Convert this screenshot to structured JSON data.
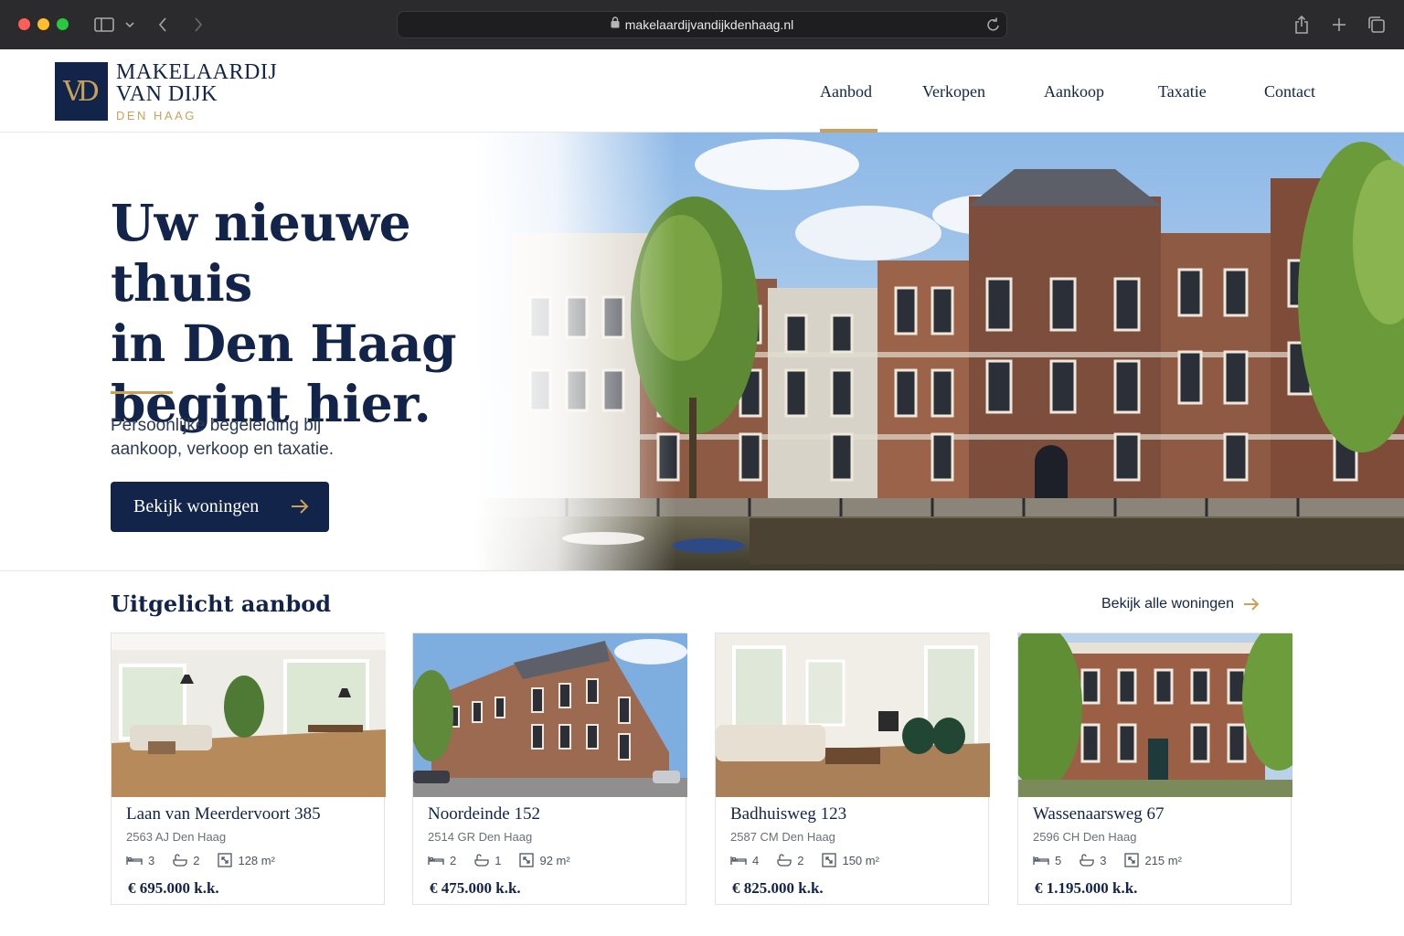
{
  "browser": {
    "url": "makelaardijvandijkdenhaag.nl"
  },
  "logo": {
    "monogram": "VD",
    "line1": "MAKELAARDIJ",
    "line2": "VAN DIJK",
    "city": "DEN HAAG"
  },
  "nav": {
    "items": [
      "Aanbod",
      "Verkopen",
      "Aankoop",
      "Taxatie",
      "Contact"
    ],
    "active": "Aanbod"
  },
  "hero": {
    "title_line1": "Uw nieuwe thuis",
    "title_line2": "in Den Haag",
    "title_line3": "begint hier.",
    "subtitle_line1": "Persoonlijke begeleiding bij",
    "subtitle_line2": "aankoop, verkoop en taxatie.",
    "button": "Bekijk woningen"
  },
  "featured": {
    "title": "Uitgelicht aanbod",
    "link": "Bekijk alle woningen",
    "listings": [
      {
        "street": "Laan van Meerdervoort 385",
        "zip": "2563 AJ Den Haag",
        "bedrooms": "3",
        "bathrooms": "2",
        "area": "128 m²",
        "price": "€ 695.000 k.k.",
        "photo": "interior-living-room"
      },
      {
        "street": "Noordeinde 152",
        "zip": "2514 GR Den Haag",
        "bedrooms": "2",
        "bathrooms": "1",
        "area": "92 m²",
        "price": "€ 475.000 k.k.",
        "photo": "exterior-street"
      },
      {
        "street": "Badhuisweg 123",
        "zip": "2587 CM Den Haag",
        "bedrooms": "4",
        "bathrooms": "2",
        "area": "150 m²",
        "price": "€ 825.000 k.k.",
        "photo": "interior-lounge"
      },
      {
        "street": "Wassenaarsweg 67",
        "zip": "2596 CH Den Haag",
        "bedrooms": "5",
        "bathrooms": "3",
        "area": "215 m²",
        "price": "€ 1.195.000 k.k.",
        "photo": "exterior-villa"
      }
    ]
  },
  "colors": {
    "navy": "#13244a",
    "gold": "#c9a25a"
  }
}
